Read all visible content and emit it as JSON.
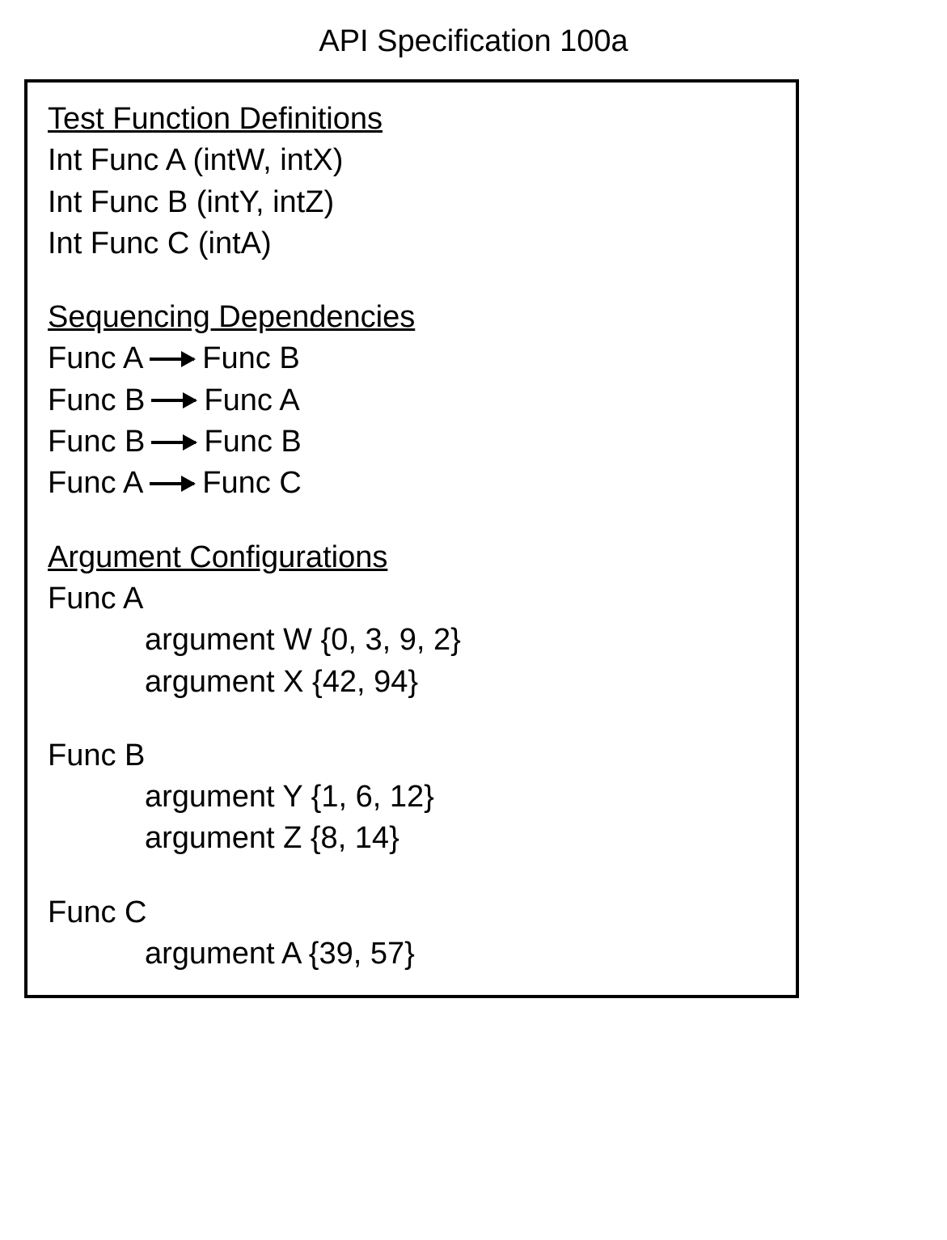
{
  "title": "API Specification 100a",
  "sections": {
    "test_functions": {
      "heading": "Test Function Definitions",
      "items": [
        "Int Func A (intW, intX)",
        "Int Func B (intY, intZ)",
        "Int Func C (intA)"
      ]
    },
    "sequencing": {
      "heading": "Sequencing Dependencies",
      "deps": [
        {
          "from": "Func A",
          "to": "Func B"
        },
        {
          "from": "Func B",
          "to": "Func A"
        },
        {
          "from": "Func B",
          "to": "Func B"
        },
        {
          "from": "Func A",
          "to": "Func C"
        }
      ]
    },
    "arguments": {
      "heading": "Argument Configurations",
      "funcs": [
        {
          "name": "Func A",
          "args": [
            "argument W {0, 3, 9, 2}",
            "argument X {42, 94}"
          ]
        },
        {
          "name": "Func B",
          "args": [
            "argument Y {1, 6, 12}",
            "argument Z {8, 14}"
          ]
        },
        {
          "name": "Func C",
          "args": [
            "argument A {39, 57}"
          ]
        }
      ]
    }
  }
}
